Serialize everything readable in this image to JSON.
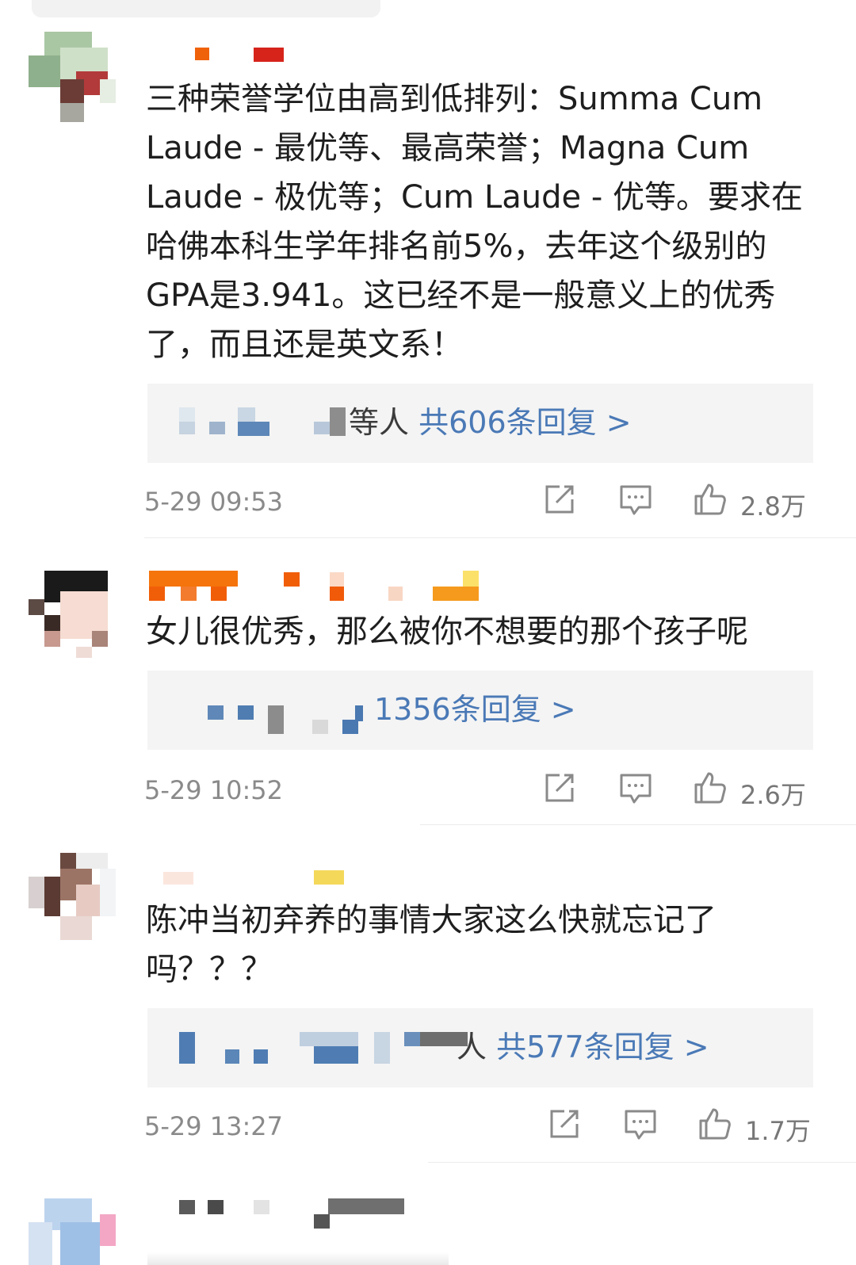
{
  "comments": [
    {
      "text": "三种荣誉学位由高到低排列：Summa Cum Laude - 最优等、最高荣誉；Magna Cum Laude - 极优等；Cum Laude - 优等。要求在哈佛本科生学年排名前5%，去年这个级别的GPA是3.941。这已经不是一般意义上的优秀了，而且还是英文系！",
      "reply_suffix": "等人",
      "reply_count_text": "共606条回复 >",
      "time": "5-29 09:53",
      "likes": "2.8万"
    },
    {
      "text": "女儿很优秀，那么被你不想要的那个孩子呢",
      "reply_suffix": "",
      "reply_count_text": "1356条回复 >",
      "time": "5-29 10:52",
      "likes": "2.6万"
    },
    {
      "text": "陈冲当初弃养的事情大家这么快就忘记了吗？？？",
      "reply_suffix": "人",
      "reply_count_text": "共577条回复 >",
      "time": "5-29 13:27",
      "likes": "1.7万"
    }
  ],
  "icons": {
    "share": "share-icon",
    "comment": "comment-icon",
    "like": "thumbs-up-icon"
  },
  "colors": {
    "link": "#4a79b6",
    "time": "#8a8a8a",
    "reply_bg": "#f4f4f4"
  }
}
